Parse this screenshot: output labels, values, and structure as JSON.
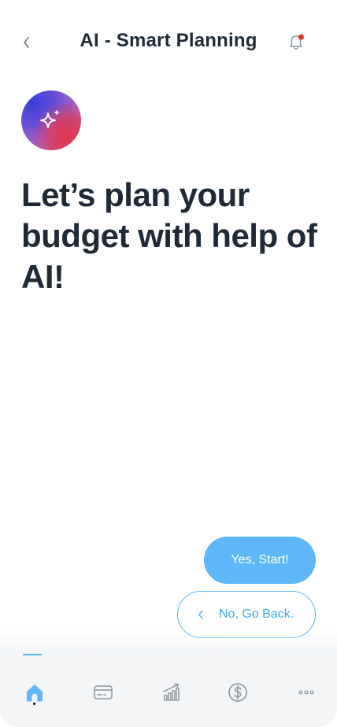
{
  "header": {
    "title": "AI - Smart Planning",
    "back_icon": "chevron-left-icon",
    "notification_icon": "bell-icon",
    "notification_dot_color": "#e5372f"
  },
  "hero": {
    "avatar_icon": "sparkle-icon",
    "headline": "Let’s plan your budget with help of AI!"
  },
  "actions": {
    "primary_label": "Yes, Start!",
    "secondary_label": "No, Go Back.",
    "accent_color": "#5db7f8"
  },
  "tabbar": {
    "active": "home",
    "tabs": [
      {
        "id": "home",
        "icon": "home-icon"
      },
      {
        "id": "cards",
        "icon": "credit-card-icon"
      },
      {
        "id": "analytics",
        "icon": "chart-trend-icon"
      },
      {
        "id": "money",
        "icon": "dollar-icon"
      },
      {
        "id": "more",
        "icon": "more-icon"
      }
    ]
  }
}
